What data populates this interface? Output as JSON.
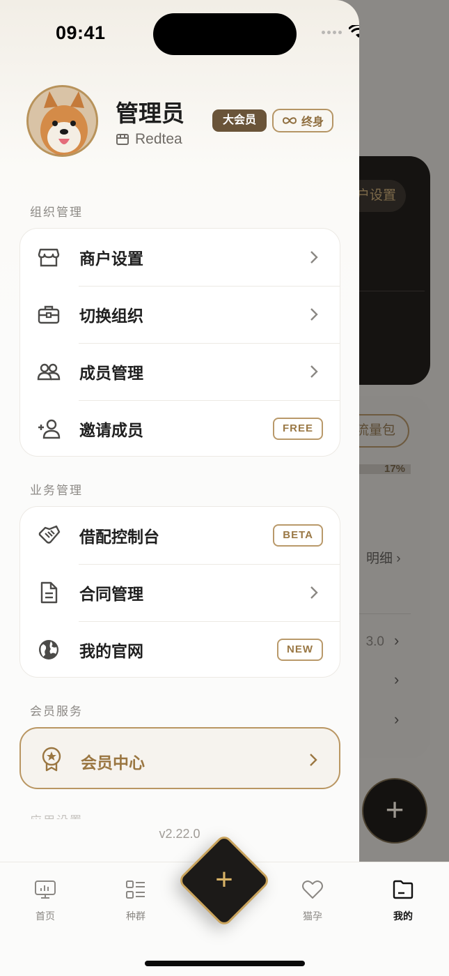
{
  "status_bar": {
    "time": "09:41"
  },
  "background": {
    "merchant_pill": "户设置",
    "traffic_pill": "流量包",
    "progress": {
      "label": "17%",
      "fraction": 0.17
    },
    "detail_link": "明细",
    "version_partial": "3.0"
  },
  "profile": {
    "name": "管理员",
    "org": "Redtea",
    "badge_vip": "大会员",
    "badge_lifetime": "终身"
  },
  "sections": {
    "org_title": "组织管理",
    "business_title": "业务管理",
    "member_title": "会员服务",
    "app_title_partial": "应用设置"
  },
  "org_items": [
    {
      "label": "商户设置",
      "icon": "store-icon"
    },
    {
      "label": "切换组织",
      "icon": "briefcase-icon"
    },
    {
      "label": "成员管理",
      "icon": "members-icon"
    },
    {
      "label": "邀请成员",
      "icon": "add-user-icon",
      "tag": "FREE"
    }
  ],
  "business_items": [
    {
      "label": "借配控制台",
      "icon": "handshake-icon",
      "tag": "BETA"
    },
    {
      "label": "合同管理",
      "icon": "document-icon"
    },
    {
      "label": "我的官网",
      "icon": "globe-icon",
      "tag": "NEW"
    }
  ],
  "member_center": {
    "label": "会员中心",
    "icon": "award-icon"
  },
  "version": "v2.22.0",
  "tabs": [
    {
      "label": "首页",
      "icon": "monitor-chart-icon"
    },
    {
      "label": "种群",
      "icon": "list-grid-icon"
    },
    {
      "label": "猫孕",
      "icon": "heart-icon"
    },
    {
      "label": "我的",
      "icon": "folder-icon",
      "active": true
    }
  ],
  "colors": {
    "accent": "#b8935b",
    "vip_badge": "#6a5439",
    "dark": "#1c1a18"
  }
}
